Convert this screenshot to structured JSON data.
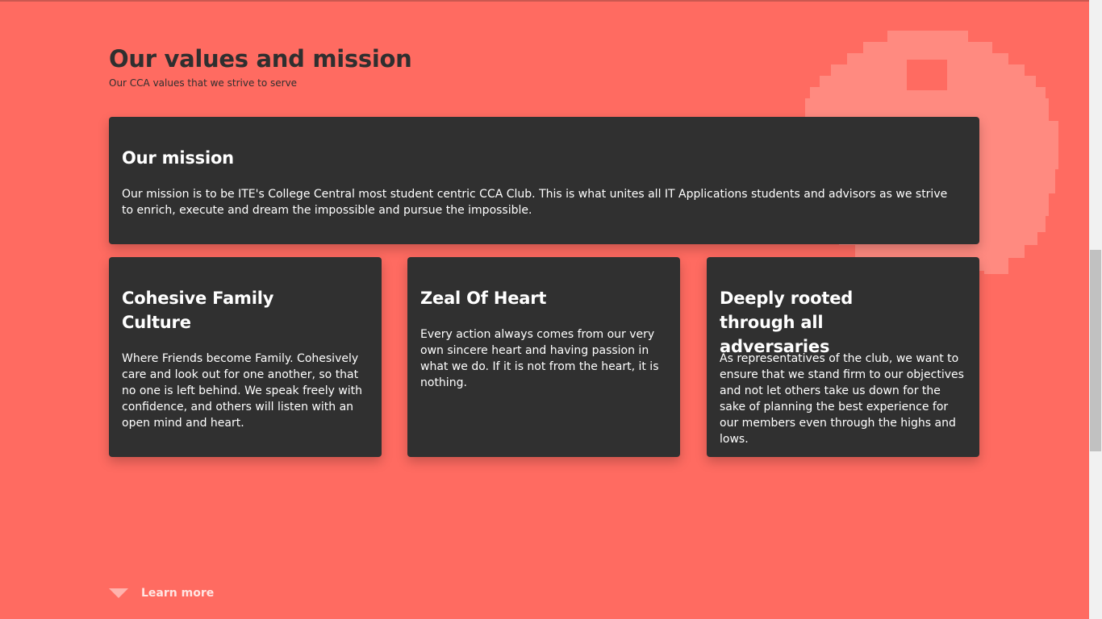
{
  "header": {
    "title": "Our values and mission",
    "subtitle": "Our CCA values that we strive to serve"
  },
  "mission": {
    "title": "Our mission",
    "text": "Our mission is to be ITE's College Central most student centric CCA Club. This is what unites all IT Applications students and advisors as we strive to enrich, execute and dream the impossible and pursue the impossible."
  },
  "values": [
    {
      "title": "Cohesive Family Culture",
      "text": "Where Friends become Family. Cohesively care and look out for one another, so that no one is left behind. We speak freely with confidence, and others will listen with an open mind and heart."
    },
    {
      "title": "Zeal Of Heart",
      "text": "Every action always comes from our very own sincere heart and having passion in what we do. If it is not from the heart, it is nothing."
    },
    {
      "title": "Deeply rooted through all adversaries",
      "text": "As representatives of the club, we want to ensure that we stand firm to our objectives and not let others take us down for the sake of planning the best experience for our members even through the highs and lows."
    }
  ],
  "footer": {
    "learn_more": "Learn more"
  },
  "colors": {
    "background": "#ff6b61",
    "card": "#303030",
    "title_text": "#2f2f2f",
    "card_text": "#ffffff",
    "decoration": "#ff8a80"
  },
  "icons": {
    "learn_more": "triangle-down-icon",
    "decoration": "pixel-circle-icon"
  }
}
